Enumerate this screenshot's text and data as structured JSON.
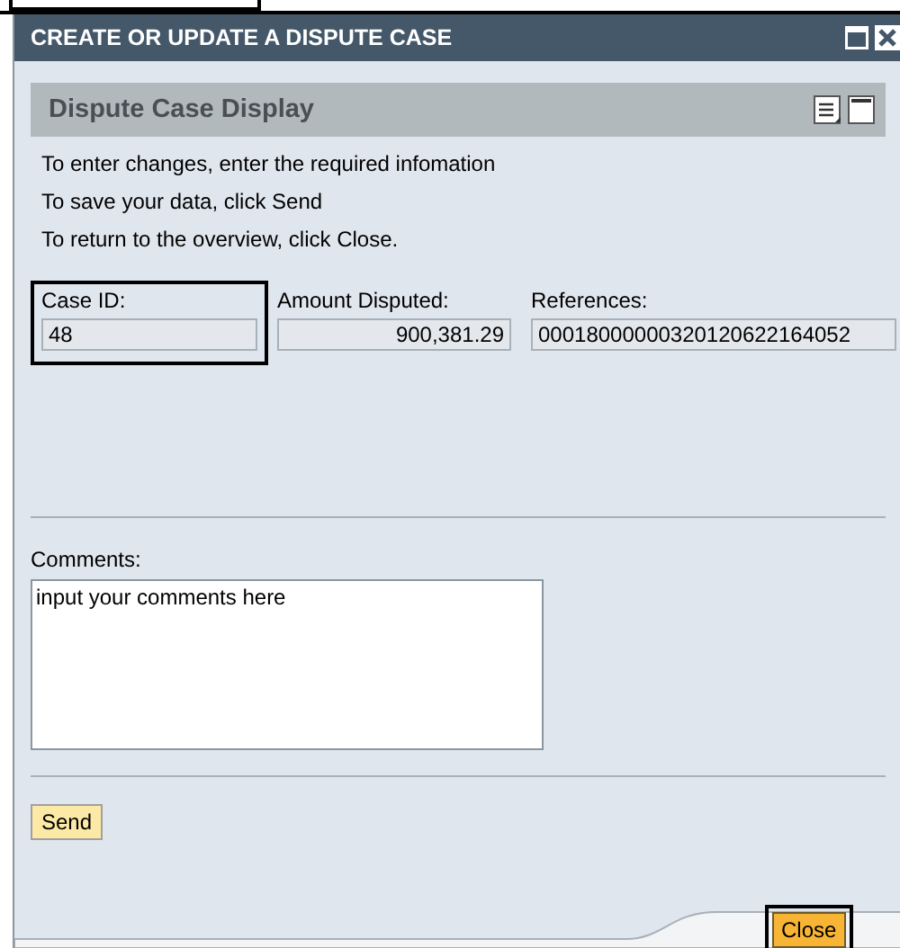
{
  "window": {
    "title": "CREATE OR UPDATE A DISPUTE CASE"
  },
  "panel": {
    "title": "Dispute Case Display"
  },
  "instructions": [
    "To enter changes, enter the required infomation",
    "To save your data, click Send",
    "To return to the overview, click Close."
  ],
  "fields": [
    {
      "label": "Case ID:",
      "value": "48",
      "kind": "text",
      "highlighted": true
    },
    {
      "label": "Amount Disputed:",
      "value": "900,381.29",
      "kind": "amount",
      "highlighted": false
    },
    {
      "label": "References:",
      "value": "00018000000320120622164052",
      "kind": "text",
      "highlighted": false
    }
  ],
  "comments": {
    "label": "Comments:",
    "value": "input your comments here"
  },
  "send_button": {
    "label": "Send"
  },
  "close_button": {
    "label": "Close",
    "highlighted": true
  }
}
